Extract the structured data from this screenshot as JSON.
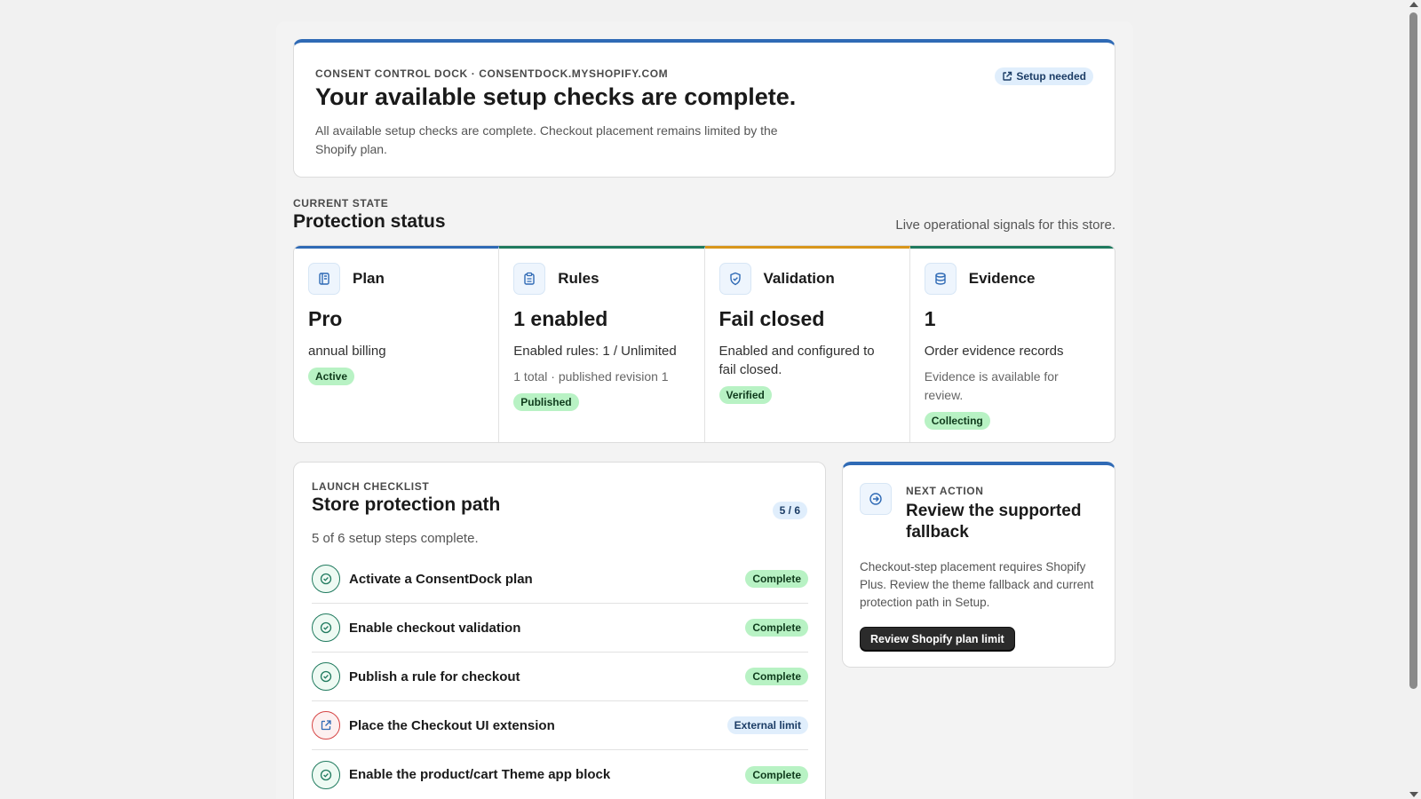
{
  "hero": {
    "eyebrow": "CONSENT CONTROL DOCK · CONSENTDOCK.MYSHOPIFY.COM",
    "title": "Your available setup checks are complete.",
    "description": "All available setup checks are complete. Checkout placement remains limited by the Shopify plan.",
    "badge": "Setup needed",
    "badge_icon": "external-link-icon"
  },
  "status_section": {
    "eyebrow": "CURRENT STATE",
    "title": "Protection status",
    "subtitle": "Live operational signals for this store."
  },
  "status_cards": [
    {
      "label": "Plan",
      "icon": "plan-icon",
      "value": "Pro",
      "detail": "annual billing",
      "sub": "",
      "pill": "Active",
      "accent": "#2f6ab5"
    },
    {
      "label": "Rules",
      "icon": "clipboard-icon",
      "value": "1 enabled",
      "detail": "Enabled rules: 1 / Unlimited",
      "sub": "1 total · published revision 1",
      "pill": "Published",
      "accent": "#1f7a5e"
    },
    {
      "label": "Validation",
      "icon": "shield-check-icon",
      "value": "Fail closed",
      "detail": "Enabled and configured to fail closed.",
      "sub": "",
      "pill": "Verified",
      "accent": "#d8961b"
    },
    {
      "label": "Evidence",
      "icon": "database-icon",
      "value": "1",
      "detail": "Order evidence records",
      "sub": "Evidence is available for review.",
      "pill": "Collecting",
      "accent": "#1f7a5e"
    }
  ],
  "checklist": {
    "eyebrow": "LAUNCH CHECKLIST",
    "title": "Store protection path",
    "count": "5 / 6",
    "summary": "5 of 6 setup steps complete.",
    "items": [
      {
        "label": "Activate a ConsentDock plan",
        "status": "Complete"
      },
      {
        "label": "Enable checkout validation",
        "status": "Complete"
      },
      {
        "label": "Publish a rule for checkout",
        "status": "Complete"
      },
      {
        "label": "Place the Checkout UI extension",
        "status": "External limit"
      },
      {
        "label": "Enable the product/cart Theme app block",
        "status": "Complete"
      }
    ]
  },
  "next_action": {
    "eyebrow": "NEXT ACTION",
    "title": "Review the supported fallback",
    "description": "Checkout-step placement requires Shopify Plus. Review the theme fallback and current protection path in Setup.",
    "button": "Review Shopify plan limit",
    "icon": "arrow-circle-right-icon"
  },
  "colors": {
    "accent_blue": "#2f6ab5",
    "accent_green": "#1f7a5e",
    "accent_orange": "#d8961b",
    "success_pill": "#b8f2c4",
    "info_pill": "#e0eefc",
    "warn_ring": "#d64545"
  }
}
